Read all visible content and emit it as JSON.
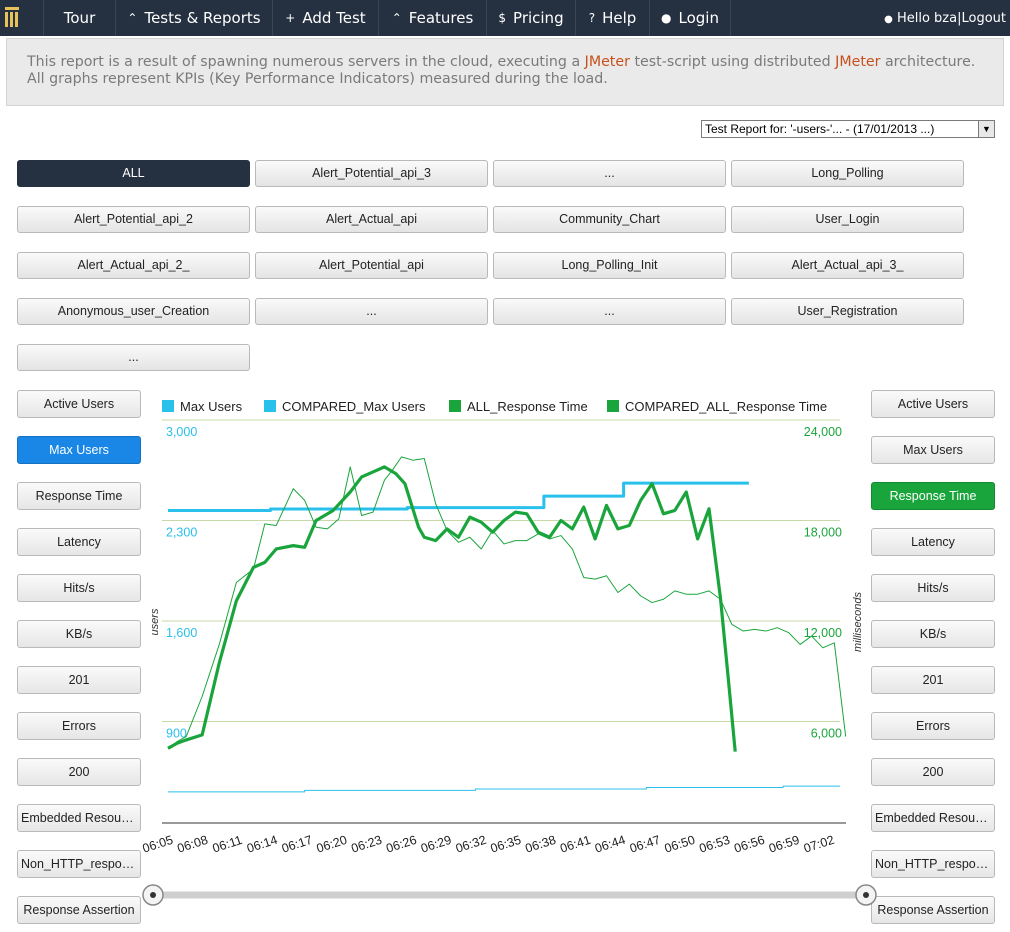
{
  "nav": {
    "items": [
      {
        "label": "Tour",
        "icon": ""
      },
      {
        "label": "Tests & Reports",
        "icon": "chevron-up-icon"
      },
      {
        "label": "Add Test",
        "icon": "plus-icon"
      },
      {
        "label": "Features",
        "icon": "chevron-up-icon"
      },
      {
        "label": "Pricing",
        "icon": "dollar-icon"
      },
      {
        "label": "Help",
        "icon": "question-icon"
      },
      {
        "label": "Login",
        "icon": "user-icon"
      }
    ],
    "hello": "Hello",
    "username": "bza",
    "logout": "Logout"
  },
  "banner": {
    "p1": "This report is a result of spawning numerous servers in the cloud, executing a ",
    "jm1": "JMeter",
    "p2": " test-script using distributed ",
    "jm2": "JMeter",
    "p3": " architecture.",
    "line2": "All graphs represent KPIs (Key Performance Indicators) measured during the load."
  },
  "report_select": {
    "value": "Test Report for:  '-users-'... - (17/01/2013  ...)"
  },
  "groups": [
    "ALL",
    "Alert_Potential_api_3",
    "...",
    "Long_Polling",
    "Alert_Potential_api_2",
    "Alert_Actual_api",
    "Community_Chart",
    "User_Login",
    "Alert_Actual_api_2_",
    "Alert_Potential_api",
    "Long_Polling_Init",
    "Alert_Actual_api_3_",
    "Anonymous_user_Creation",
    "...",
    "...",
    "User_Registration",
    "..."
  ],
  "left_buttons": [
    "Active Users",
    "Max Users",
    "Response Time",
    "Latency",
    "Hits/s",
    "KB/s",
    "201",
    "Errors",
    "200",
    "Embedded Resources",
    "Non_HTTP_response",
    "Response Assertion"
  ],
  "right_buttons": [
    "Active Users",
    "Max Users",
    "Response Time",
    "Latency",
    "Hits/s",
    "KB/s",
    "201",
    "Errors",
    "200",
    "Embedded Resources",
    "Non_HTTP_response",
    "Response Assertion"
  ],
  "colors": {
    "nav_bg": "#253040",
    "users": "#29c0ec",
    "response": "#1aa53c",
    "jmeter": "#c7501c",
    "active_blue": "#1a87e6",
    "active_green": "#1aa53c"
  },
  "chart_data": {
    "type": "line",
    "legend": [
      "Max Users",
      "COMPARED_Max Users",
      "ALL_Response Time",
      "COMPARED_ALL_Response Time"
    ],
    "legend_position": "top",
    "ylabel_left": "users",
    "ylabel_right": "milliseconds",
    "y_left_ticks": [
      "3,000",
      "2,300",
      "1,600",
      "900"
    ],
    "y_right_ticks": [
      "24,000",
      "18,000",
      "12,000",
      "6,000"
    ],
    "y_left_range": [
      200,
      3000
    ],
    "y_right_range": [
      0,
      24000
    ],
    "x_ticks": [
      "06:05",
      "06:08",
      "06:11",
      "06:14",
      "06:17",
      "06:20",
      "06:23",
      "06:26",
      "06:29",
      "06:32",
      "06:35",
      "06:38",
      "06:41",
      "06:44",
      "06:47",
      "06:50",
      "06:53",
      "06:56",
      "06:59",
      "07:02"
    ],
    "grid": true,
    "series": [
      {
        "name": "Max Users",
        "axis": "left",
        "x": [
          0,
          3,
          6,
          9,
          12,
          15,
          18,
          21,
          24,
          27,
          30,
          33,
          36,
          39,
          40,
          42,
          45,
          48,
          51
        ],
        "y": [
          2370,
          2370,
          2370,
          2380,
          2380,
          2380,
          2380,
          2390,
          2390,
          2390,
          2390,
          2470,
          2470,
          2470,
          2560,
          2560,
          2560,
          2560,
          2560
        ]
      },
      {
        "name": "COMPARED_Max Users",
        "axis": "left",
        "x": [
          0,
          3,
          6,
          9,
          12,
          15,
          18,
          21,
          24,
          27,
          30,
          33,
          36,
          39,
          42,
          45,
          48,
          51,
          54,
          57,
          59
        ],
        "y": [
          410,
          410,
          410,
          410,
          420,
          420,
          420,
          420,
          420,
          430,
          430,
          430,
          430,
          430,
          440,
          440,
          440,
          440,
          450,
          450,
          450
        ]
      },
      {
        "name": "ALL_Response Time",
        "axis": "right",
        "x": [
          0,
          0.8,
          1.6,
          3,
          4.5,
          6,
          7.5,
          8.5,
          9.5,
          11,
          12,
          13,
          14.5,
          16,
          17,
          19,
          20,
          20.8,
          22,
          22.5,
          23.5,
          24.5,
          25.5,
          26.5,
          27.5,
          28.5,
          29.5,
          30.5,
          31.5,
          32.5,
          33.5,
          34.5,
          35.5,
          36.5,
          37.5,
          38.5,
          39.5,
          40.5,
          41.5,
          42.5,
          43.5,
          44.5,
          45.5,
          46.5,
          47.5,
          48.5,
          49.2,
          49.8
        ],
        "y": [
          4400,
          4700,
          4900,
          5200,
          9500,
          13200,
          15200,
          15500,
          16300,
          16500,
          16400,
          18000,
          18600,
          19700,
          20600,
          21200,
          20800,
          20200,
          17600,
          17000,
          16800,
          17500,
          17000,
          18200,
          17900,
          17300,
          18000,
          18500,
          18400,
          17300,
          17000,
          18000,
          17500,
          18800,
          16900,
          18900,
          17500,
          17700,
          19200,
          20200,
          18400,
          18600,
          19700,
          16900,
          18700,
          13400,
          8500,
          4200
        ]
      },
      {
        "name": "COMPARED_ALL_Response Time",
        "axis": "right",
        "x": [
          0,
          0.8,
          1.6,
          3,
          4.5,
          6,
          7.5,
          8.5,
          9.5,
          11,
          12,
          13,
          14,
          15,
          16,
          17,
          18,
          19,
          19.8,
          20.5,
          21.5,
          22.5,
          23.5,
          24.5,
          25.5,
          26.5,
          27.5,
          28.5,
          29.5,
          30.5,
          31.5,
          32.5,
          33.5,
          34.5,
          35.5,
          36.5,
          37.5,
          38.5,
          39.5,
          40.5,
          41.5,
          42.5,
          43.5,
          44.5,
          45.5,
          46.5,
          47.5,
          48.5,
          49.5,
          50.5,
          51.5,
          52.5,
          53.5,
          54.5,
          55.5,
          56.5,
          57.5,
          58.5,
          59.5
        ],
        "y": [
          4400,
          4800,
          5100,
          7500,
          10600,
          14300,
          15100,
          17800,
          17700,
          19900,
          19200,
          17600,
          17500,
          18100,
          21200,
          18300,
          18500,
          20400,
          21100,
          21800,
          21600,
          21700,
          19000,
          17400,
          16700,
          17000,
          16300,
          17400,
          16600,
          16800,
          16800,
          17200,
          16900,
          17100,
          16300,
          14600,
          14500,
          14700,
          13700,
          14200,
          13500,
          13100,
          13300,
          13800,
          13600,
          13600,
          13800,
          13300,
          11800,
          11400,
          11500,
          11400,
          11600,
          11300,
          10600,
          11100,
          10400,
          10700,
          5100
        ]
      }
    ]
  }
}
